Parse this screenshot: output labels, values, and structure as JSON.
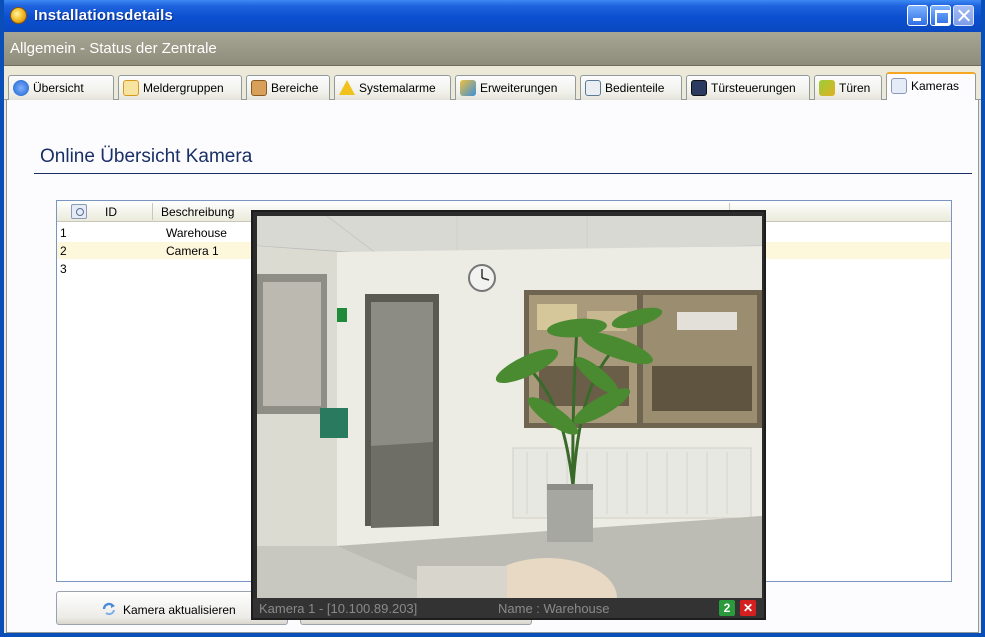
{
  "window": {
    "title": "Installationsdetails"
  },
  "header": {
    "title": "Allgemein - Status der Zentrale"
  },
  "tabs": [
    {
      "label": "Übersicht",
      "icon": "info-icon"
    },
    {
      "label": "Meldergruppen",
      "icon": "checkbox-icon"
    },
    {
      "label": "Bereiche",
      "icon": "building-icon"
    },
    {
      "label": "Systemalarme",
      "icon": "warning-icon"
    },
    {
      "label": "Erweiterungen",
      "icon": "pencil-icon"
    },
    {
      "label": "Bedienteile",
      "icon": "keypad-icon"
    },
    {
      "label": "Türsteuerungen",
      "icon": "door-controller-icon"
    },
    {
      "label": "Türen",
      "icon": "door-icon"
    },
    {
      "label": "Kameras",
      "icon": "camera-icon",
      "active": true
    }
  ],
  "main": {
    "section_title": "Online Übersicht Kamera",
    "table": {
      "columns": [
        "ID",
        "Beschreibung"
      ],
      "rows": [
        {
          "id": "1",
          "description": "Warehouse"
        },
        {
          "id": "2",
          "description": "Camera 1"
        },
        {
          "id": "3",
          "description": ""
        }
      ]
    },
    "refresh_button_label": "Kamera aktualisieren"
  },
  "video": {
    "camera_info": "Kamera 1 - [10.100.89.203]",
    "name_info": "Name : Warehouse",
    "refresh_label": "2",
    "close_label": "✕"
  },
  "colors": {
    "titlebar": "#0b4fd0",
    "header": "#8e8c7a",
    "section_title": "#1a2f66",
    "selected_row": "#fdf8dc"
  }
}
